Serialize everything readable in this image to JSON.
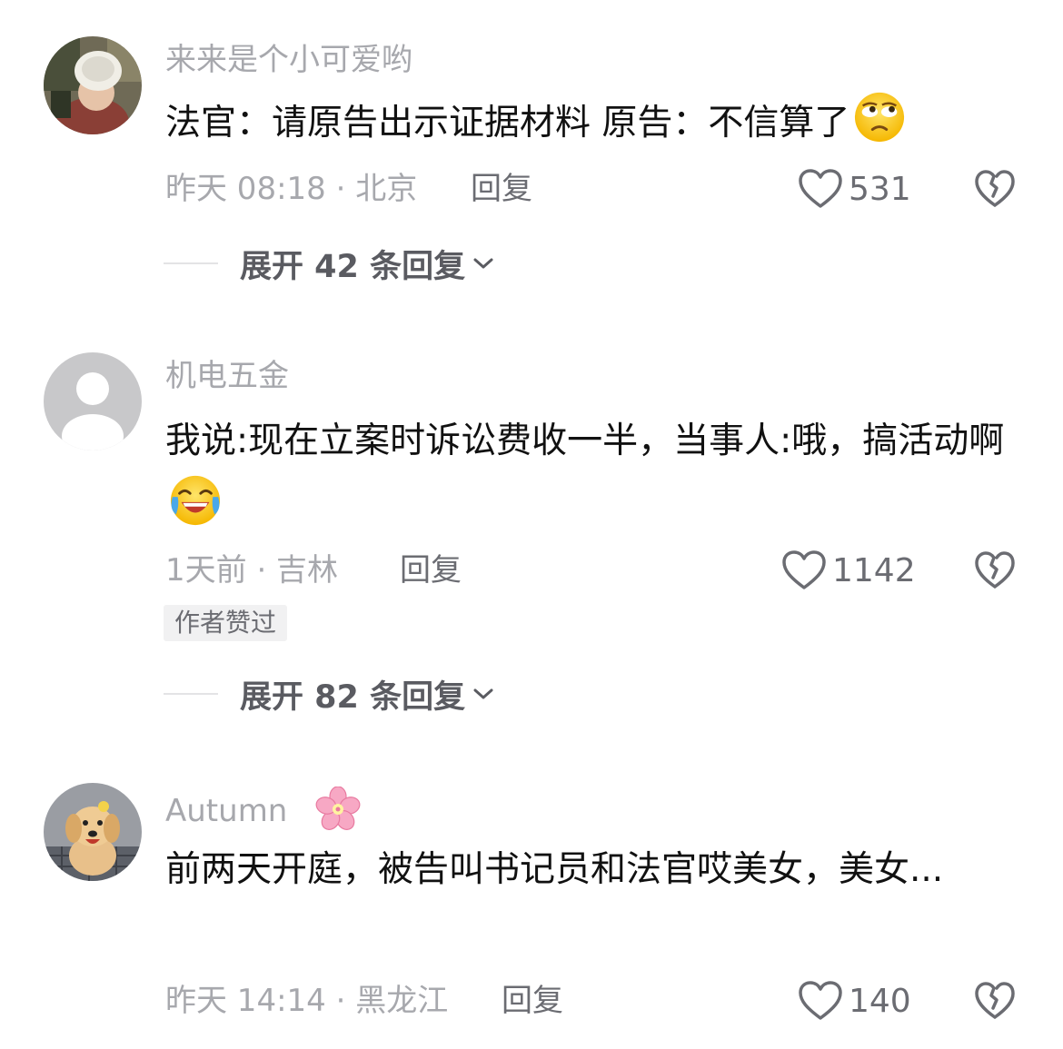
{
  "comments": [
    {
      "username": "来来是个小可爱哟",
      "text": "法官：请原告出示证据材料 原告：不信算了",
      "emoji": "eye-roll-emoji",
      "meta": "昨天 08:18 · 北京",
      "reply_label": "回复",
      "likes": "531",
      "expand_label": "展开 42 条回复"
    },
    {
      "username": "机电五金",
      "text": "我说:现在立案时诉讼费收一半，当事人:哦，搞活动啊",
      "emoji": "laugh-cry-emoji",
      "meta": "1天前 · 吉林",
      "reply_label": "回复",
      "likes": "1142",
      "badge": "作者赞过",
      "expand_label": "展开 82 条回复"
    },
    {
      "username": "Autumn",
      "username_emoji": "cherry-blossom-emoji",
      "text": "前两天开庭，被告叫书记员和法官哎美女，美女...",
      "meta": "昨天 14:14 · 黑龙江",
      "reply_label": "回复",
      "likes": "140"
    }
  ],
  "icons": {
    "like": "heart-outline-icon",
    "dislike": "broken-heart-icon",
    "expand": "chevron-down-icon"
  },
  "colors": {
    "secondary_text": "#a7a8ad",
    "primary_text": "#111111",
    "action_text": "#6b6c72"
  }
}
